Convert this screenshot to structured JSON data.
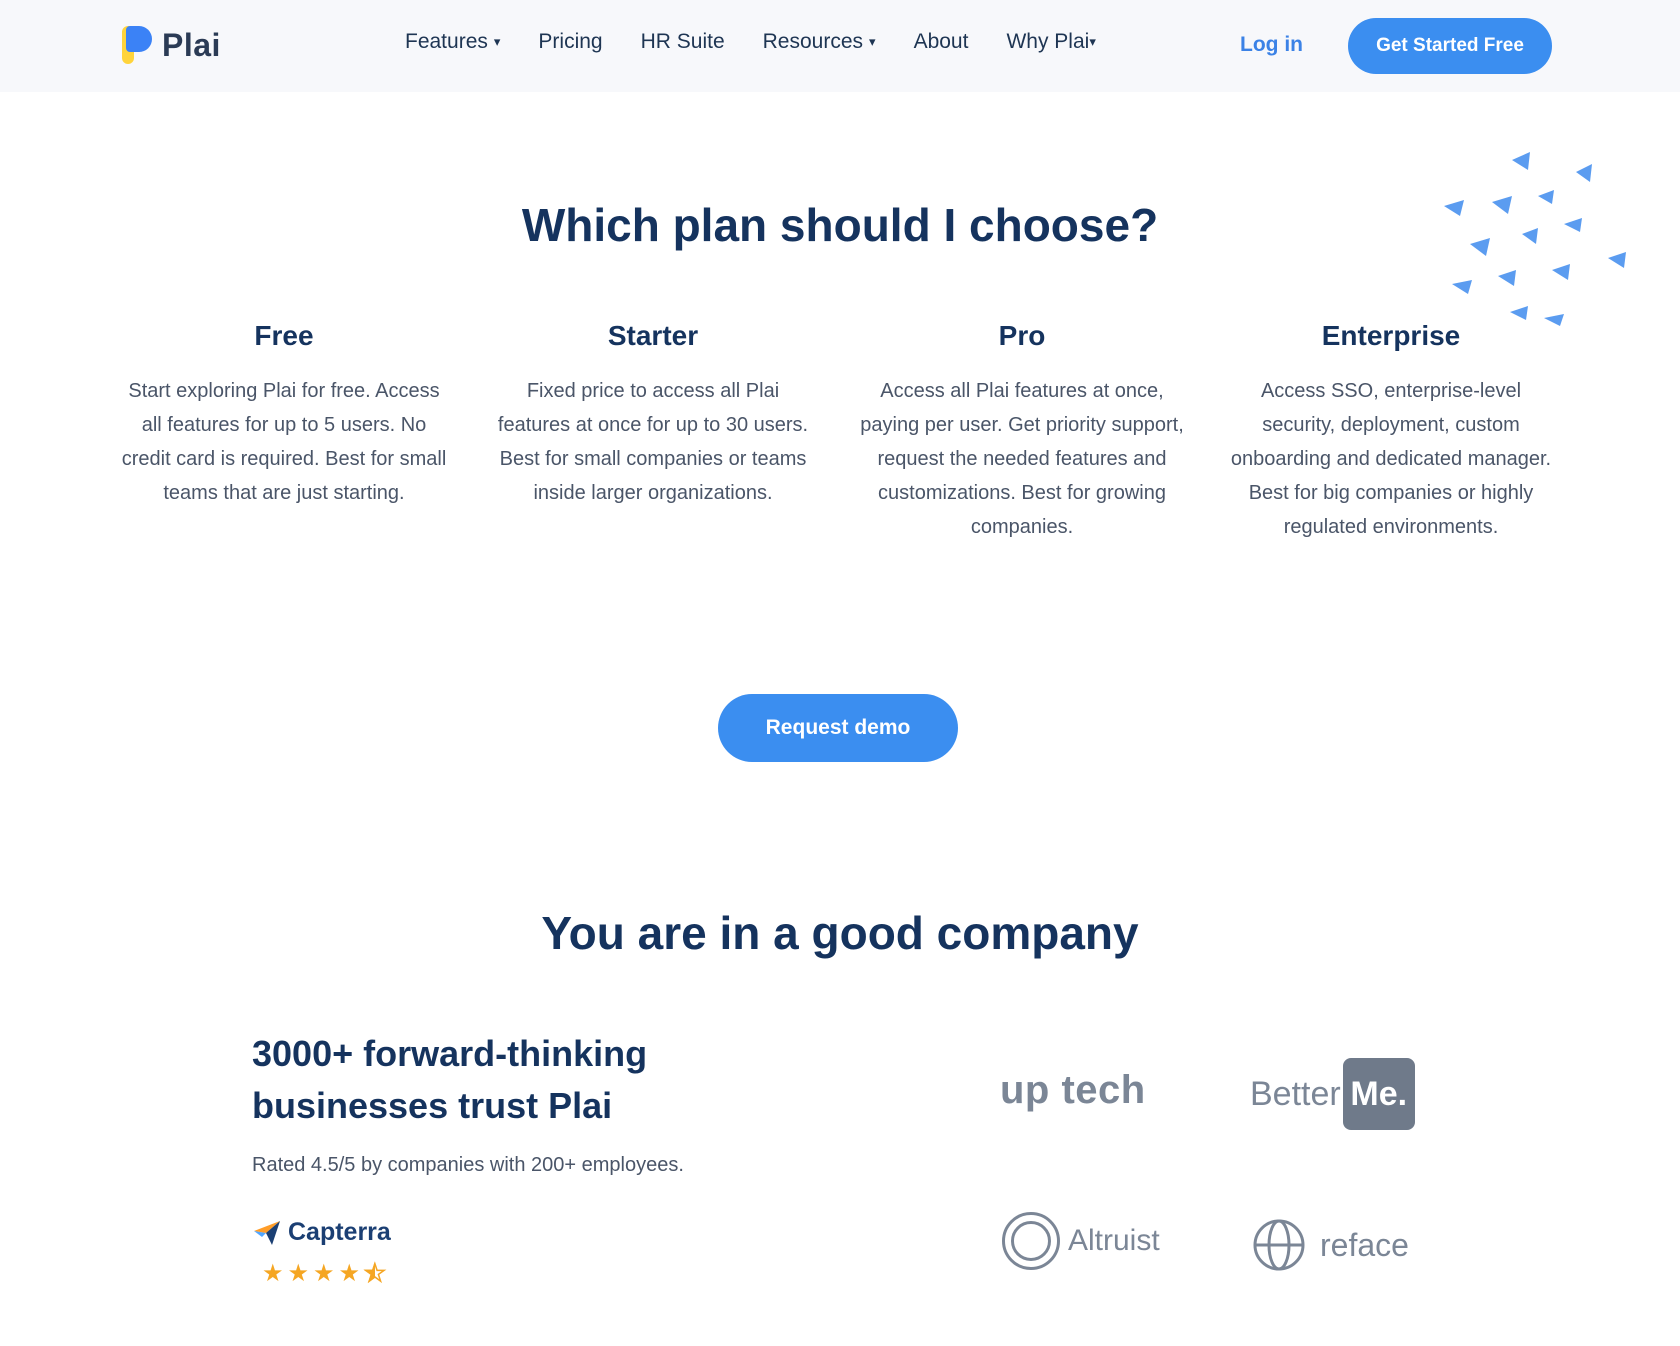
{
  "nav": {
    "brand": "Plai",
    "items": [
      {
        "label": "Features",
        "dropdown": true
      },
      {
        "label": "Pricing",
        "dropdown": false
      },
      {
        "label": "HR Suite",
        "dropdown": false
      },
      {
        "label": "Resources",
        "dropdown": true
      },
      {
        "label": "About",
        "dropdown": false
      },
      {
        "label": "Why Plai",
        "dropdown": true
      }
    ],
    "login": "Log in",
    "cta": "Get Started Free",
    "caret": "▾"
  },
  "plans_section": {
    "title": "Which plan should I choose?",
    "plans": [
      {
        "name": "Free",
        "description": "Start exploring Plai for free. Access all features for up to 5 users. No credit card is required. Best for small teams that are just starting."
      },
      {
        "name": "Starter",
        "description": "Fixed price to access all Plai features at once for up to 30 users. Best for small companies or teams inside larger organizations."
      },
      {
        "name": "Pro",
        "description": "Access all Plai features at once, paying per user. Get priority support, request the needed features and customizations. Best for growing companies."
      },
      {
        "name": "Enterprise",
        "description": "Access SSO, enterprise-level security, deployment, custom onboarding and dedicated manager. Best for big companies or highly regulated environments."
      }
    ],
    "demo_button": "Request demo"
  },
  "company_section": {
    "title": "You are in a good company",
    "trust_title": "3000+ forward-thinking businesses trust Plai",
    "rating_text": "Rated 4.5/5 by companies with 200+ employees.",
    "capterra_label": "Capterra",
    "rating_stars": 4.5,
    "logos": {
      "uptech": "up tech",
      "betterme_a": "Better",
      "betterme_b": "Me.",
      "altruist": "Altruist",
      "reface": "reface"
    }
  },
  "colors": {
    "accent": "#3b8ef0",
    "heading": "#15335e",
    "star": "#f5a623",
    "logo_yellow": "#ffd43b",
    "logo_blue": "#3b82f6"
  }
}
